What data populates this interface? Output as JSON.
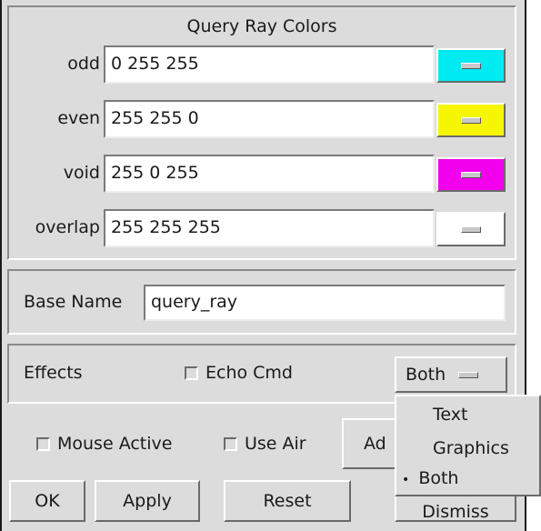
{
  "query_ray_colors": {
    "title": "Query Ray Colors",
    "rows": [
      {
        "label": "odd",
        "value": "0 255 255",
        "swatch_color": "#00eaf2"
      },
      {
        "label": "even",
        "value": "255 255 0",
        "swatch_color": "#f6f600"
      },
      {
        "label": "void",
        "value": "255 0 255",
        "swatch_color": "#f200ee"
      },
      {
        "label": "overlap",
        "value": "255 255 255",
        "swatch_color": "#ffffff"
      }
    ]
  },
  "base_name": {
    "label": "Base Name",
    "value": "query_ray"
  },
  "effects": {
    "label": "Effects",
    "echo_cmd_label": "Echo Cmd",
    "echo_cmd_checked": false,
    "selected": "Both"
  },
  "effects_menu": {
    "options": [
      "Text",
      "Graphics",
      "Both"
    ],
    "selected_marker": "•"
  },
  "options_row": {
    "mouse_active_label": "Mouse Active",
    "mouse_active_checked": false,
    "use_air_label": "Use Air",
    "use_air_checked": false,
    "advanced_label_visible": "Ad"
  },
  "buttons": {
    "ok": "OK",
    "apply": "Apply",
    "reset": "Reset",
    "dismiss": "Dismiss"
  }
}
